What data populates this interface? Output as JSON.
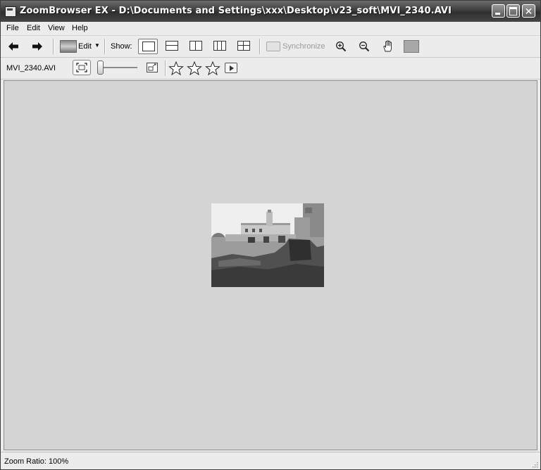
{
  "window": {
    "title": "ZoomBrowser EX - D:\\Documents and Settings\\xxx\\Desktop\\v23_soft\\MVI_2340.AVI",
    "controls": {
      "minimize": "",
      "maximize": "",
      "close": "✕"
    }
  },
  "menu": {
    "items": [
      "File",
      "Edit",
      "View",
      "Help"
    ]
  },
  "toolbar": {
    "edit_label": "Edit",
    "show_label": "Show:",
    "sync_label": "Synchronize",
    "icons": [
      "back-arrow-icon",
      "forward-arrow-icon",
      "edit-image-icon",
      "layout-single-icon",
      "layout-two-horizontal-icon",
      "layout-two-vertical-icon",
      "layout-three-vertical-icon",
      "layout-four-grid-icon",
      "synchronize-icon",
      "zoom-in-icon",
      "zoom-out-icon",
      "hand-pan-icon",
      "background-color-icon"
    ]
  },
  "viewer_toolbar": {
    "file_name": "MVI_2340.AVI",
    "rating_stars": 3,
    "icons": [
      "fit-to-window-icon",
      "zoom-slider",
      "restore-size-icon",
      "star-icon",
      "play-icon"
    ]
  },
  "status": {
    "zoom_text": "Zoom Ratio: 100%"
  },
  "colors": {
    "title_bar": "#3d3d3d",
    "viewer_background": "#d4d4d4",
    "chrome": "#ececec"
  }
}
